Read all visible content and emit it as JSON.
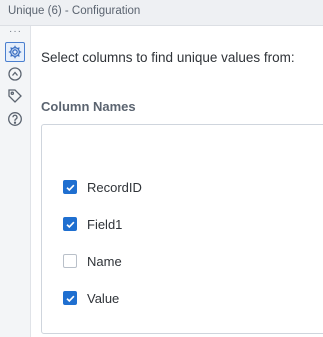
{
  "window": {
    "title": "Unique (6) - Configuration"
  },
  "sidebar": {
    "overflow_glyph": "···",
    "icons": [
      {
        "name": "gear-icon",
        "active": true
      },
      {
        "name": "refresh-icon",
        "active": false
      },
      {
        "name": "tag-icon",
        "active": false
      },
      {
        "name": "help-icon",
        "active": false
      }
    ]
  },
  "main": {
    "instruction": "Select columns to find unique values from:",
    "section_label": "Column Names",
    "columns": [
      {
        "label": "RecordID",
        "checked": true
      },
      {
        "label": "Field1",
        "checked": true
      },
      {
        "label": "Name",
        "checked": false
      },
      {
        "label": "Value",
        "checked": true
      }
    ]
  },
  "colors": {
    "accent": "#1f6fd0",
    "title_bar": "#eef0f3"
  }
}
